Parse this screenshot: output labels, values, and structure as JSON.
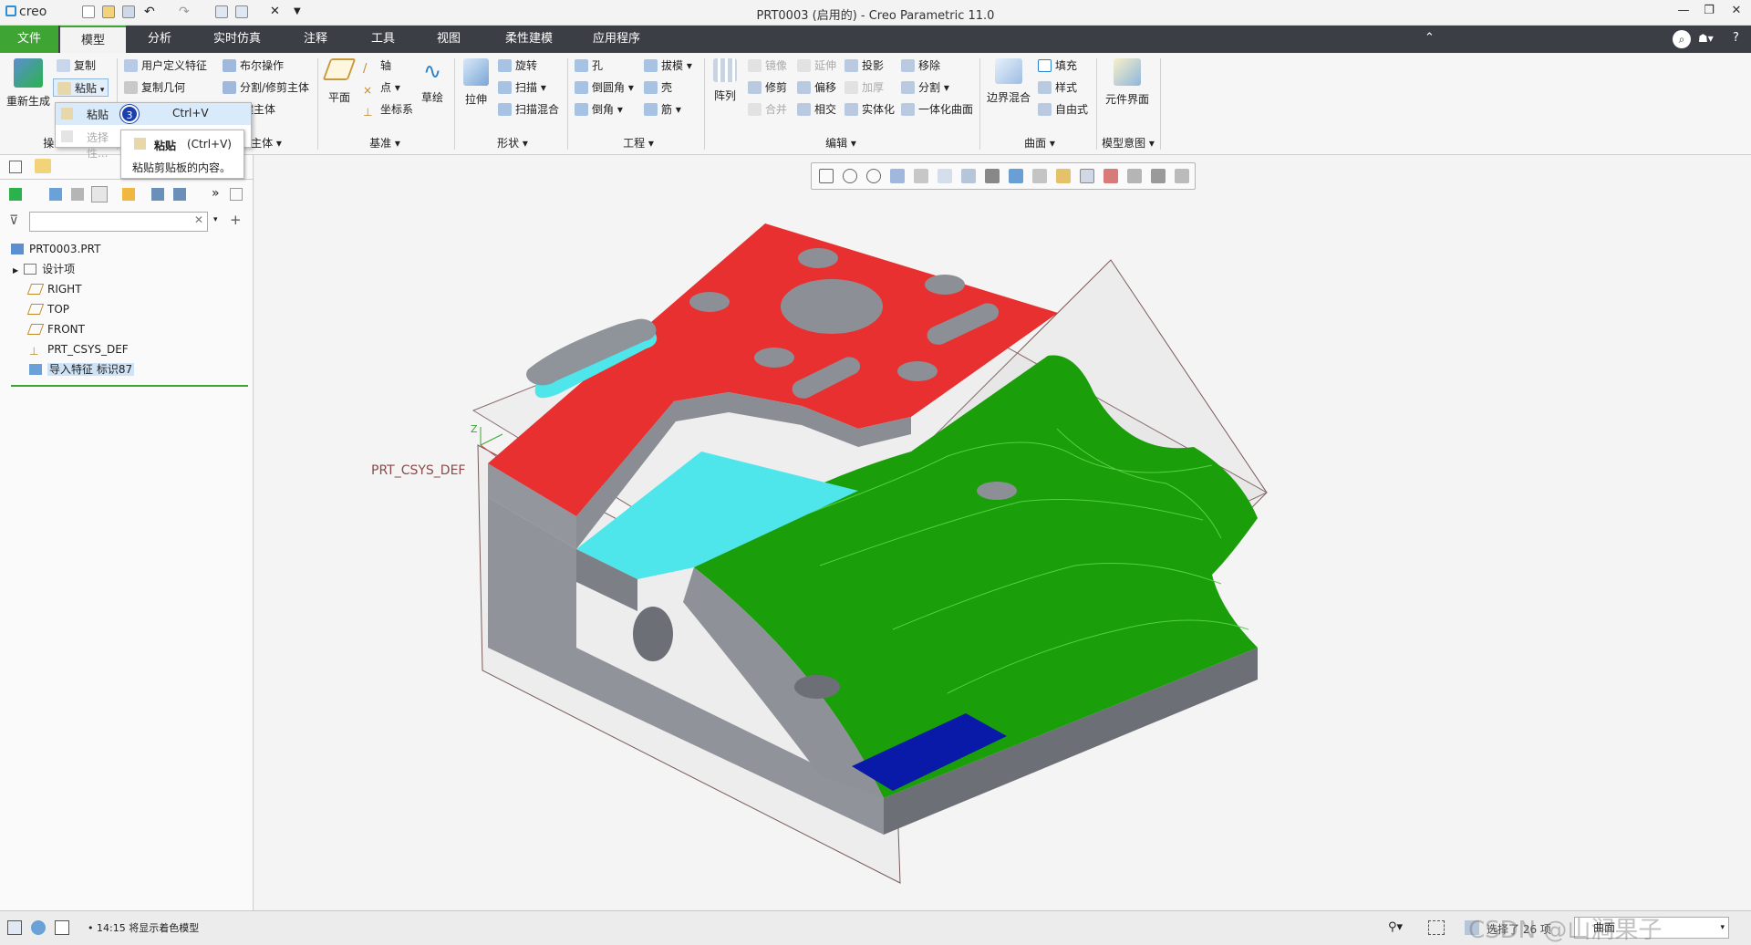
{
  "app": {
    "logo": "creo",
    "window_title": "PRT0003 (启用的) - Creo Parametric 11.0"
  },
  "tabs": [
    "文件",
    "模型",
    "分析",
    "实时仿真",
    "注释",
    "工具",
    "视图",
    "柔性建模",
    "应用程序"
  ],
  "ribbon": {
    "operations": {
      "regenerate": "重新生成",
      "copy": "复制",
      "paste": "粘贴",
      "group": "操..."
    },
    "get_data": {
      "udf": "用户定义特征",
      "copy_geom": "复制几何",
      "boolean": "布尔操作",
      "split_trim": "分割/修剪主体",
      "new_body": "建主体",
      "body_group": "主体"
    },
    "datum": {
      "plane": "平面",
      "axis": "轴",
      "point": "点",
      "csys": "坐标系",
      "sketch": "草绘",
      "group": "基准"
    },
    "shapes": {
      "extrude": "拉伸",
      "revolve": "旋转",
      "sweep": "扫描",
      "swept_blend": "扫描混合",
      "group": "形状"
    },
    "engineering": {
      "hole": "孔",
      "draft": "拔模",
      "round": "倒圆角",
      "shell": "壳",
      "chamfer": "倒角",
      "rib": "筋",
      "group": "工程"
    },
    "editing": {
      "pattern": "阵列",
      "mirror": "镜像",
      "extend": "延伸",
      "project": "投影",
      "remove": "移除",
      "trim": "修剪",
      "offset": "偏移",
      "thicken": "加厚",
      "split": "分割",
      "merge": "合并",
      "intersect": "相交",
      "solidify": "实体化",
      "unified": "一体化曲面",
      "group": "编辑"
    },
    "surfaces": {
      "boundary": "边界混合",
      "fill": "填充",
      "style": "样式",
      "freestyle": "自由式",
      "group": "曲面"
    },
    "model_intent": {
      "component_if": "元件界面",
      "group": "模型意图"
    }
  },
  "paste_menu": {
    "paste": "粘贴",
    "shortcut": "Ctrl+V",
    "badge": "3",
    "paste_selected": "选择性...",
    "tooltip_title": "粘贴",
    "tooltip_shortcut": "(Ctrl+V)",
    "tooltip_desc": "粘贴剪贴板的内容。"
  },
  "model_tree": {
    "search_placeholder": "",
    "root": "PRT0003.PRT",
    "items": [
      "设计项",
      "RIGHT",
      "TOP",
      "FRONT",
      "PRT_CSYS_DEF",
      "导入特征 标识87"
    ]
  },
  "viewport": {
    "csys_label": "PRT_CSYS_DEF",
    "axis_label": "Z"
  },
  "status": {
    "message": "14:15 将显示着色模型",
    "selection": "选择了 26 项",
    "filter": "曲面",
    "watermark": "CSDN @山涧果子"
  },
  "colors": {
    "accent": "#3ea535",
    "tabbar": "#3b3f45",
    "red_face": "#e83030",
    "green_face": "#1a9e0a",
    "cyan_face": "#4ee6ea",
    "blue_face": "#0a1aa8",
    "gray_face": "#8f949a"
  }
}
